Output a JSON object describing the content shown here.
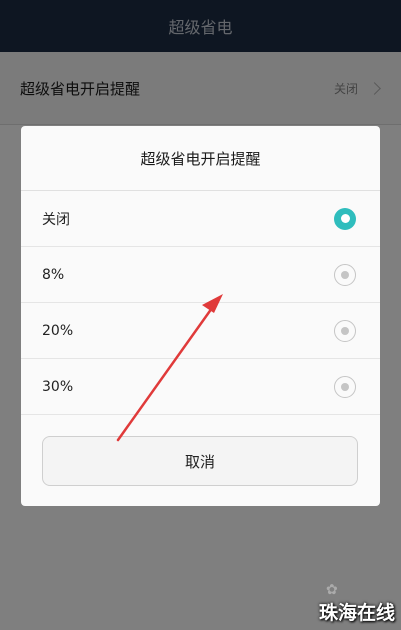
{
  "topbar": {
    "title": "超级省电"
  },
  "setting": {
    "label": "超级省电开启提醒",
    "value": "关闭"
  },
  "dialog": {
    "title": "超级省电开启提醒",
    "options": [
      {
        "label": "关闭",
        "selected": true
      },
      {
        "label": "8%",
        "selected": false
      },
      {
        "label": "20%",
        "selected": false
      },
      {
        "label": "30%",
        "selected": false
      }
    ],
    "cancel_label": "取消"
  },
  "colors": {
    "topbar": "#1d2d45",
    "radio_selected": "#2fbdbd",
    "annotation_arrow": "#e03a3a"
  },
  "watermark": {
    "text": "珠海在线"
  }
}
